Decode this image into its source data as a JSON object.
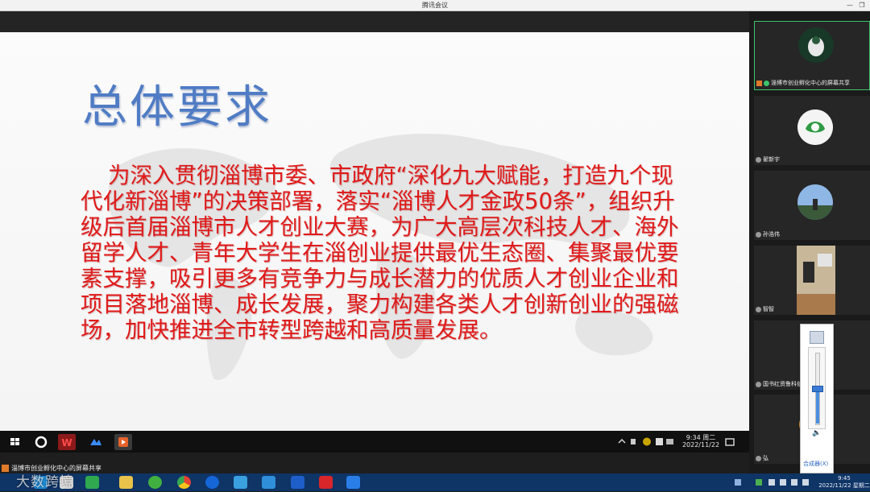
{
  "window": {
    "title": "腾讯会议"
  },
  "slide": {
    "title": "总体要求",
    "body": "为深入贯彻淄博市委、市政府“深化九大赋能，打造九个现代化新淄博”的决策部署，落实“淄博人才金政50条”，组织升级后首届淄博市人才创业大赛，为广大高层次科技人才、海外留学人才、青年大学生在淄创业提供最优生态圈、集聚最优要素支撑，吸引更多有竞争力与成长潜力的优质人才创业企业和项目落地淄博、成长发展，聚力构建各类人才创新创业的强磁场，加快推进全市转型跨越和高质量发展。"
  },
  "shared_clock": {
    "time": "9:34 周二",
    "date": "2022/11/22"
  },
  "share_indicator": {
    "label": "淄博市创业孵化中心的屏幕共享"
  },
  "participants": [
    {
      "name": "淄博市创业孵化中心的屏幕共享"
    },
    {
      "name": "翟新宇"
    },
    {
      "name": "孙浩伟"
    },
    {
      "name": "智智"
    },
    {
      "name": "国书红资鲁科依"
    },
    {
      "name": "弘"
    }
  ],
  "volume_popup": {
    "mixer_label": "合成器(X)",
    "level": 0.5
  },
  "os_clock": {
    "time": "9:45",
    "date": "2022/11/22 星期二"
  },
  "watermark": "大数跨境",
  "colors": {
    "slide_title": "#4f7cc4",
    "slide_body": "#e01a1a",
    "taskbar": "#0f3466"
  }
}
